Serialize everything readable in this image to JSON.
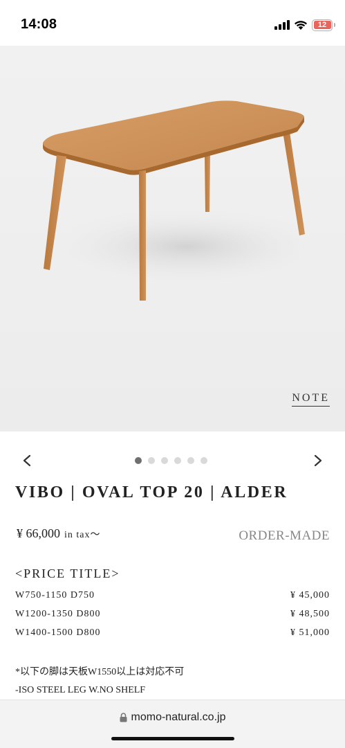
{
  "status_bar": {
    "time": "14:08",
    "battery_level": "12",
    "icons": [
      "cellular-signal-icon",
      "wifi-icon",
      "battery-icon"
    ]
  },
  "hero": {
    "image": "alder-oval-top-dining-table-photo",
    "note_label": "NOTE"
  },
  "carousel": {
    "slide_count": 6,
    "active_index": 0,
    "prev_icon": "chevron-left-icon",
    "next_icon": "chevron-right-icon"
  },
  "product": {
    "title": "VIBO | OVAL TOP 20 | ALDER",
    "price": "¥ 66,000",
    "tax_label": "in tax～",
    "order_label": "ORDER-MADE"
  },
  "price_table": {
    "title": "<PRICE TITLE>",
    "rows": [
      {
        "size": "W750-1150 D750",
        "price": "¥ 45,000"
      },
      {
        "size": "W1200-1350 D800",
        "price": "¥ 48,500"
      },
      {
        "size": "W1400-1500 D800",
        "price": "¥ 51,000"
      }
    ]
  },
  "notes": [
    "*以下の脚は天板W1550以上は対応不可",
    "-ISO STEEL LEG W.NO SHELF"
  ],
  "browser": {
    "url": "momo-natural.co.jp",
    "lock_icon": "lock-icon"
  },
  "colors": {
    "wood": "#c8894f",
    "hero_bg": "#efefef",
    "battery_low": "#e8645c"
  }
}
